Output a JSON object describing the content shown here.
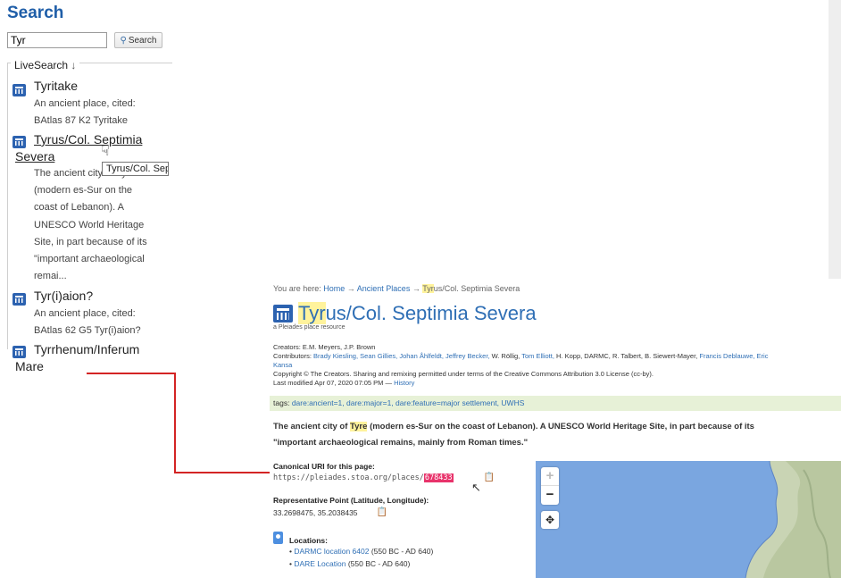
{
  "search": {
    "title": "Search",
    "query": "Tyr",
    "button_label": "Search",
    "livesearch_label": "LiveSearch",
    "livesearch_arrow": "↓"
  },
  "results": [
    {
      "title": "Tyritake",
      "desc": [
        "An ancient place, cited:",
        "BAtlas 87 K2 Tyritake"
      ]
    },
    {
      "title_line1": "Tyrus/Col. Septimia",
      "title_line2": "Severa",
      "desc": [
        "The ancient city of Tyre",
        "(modern es-Sur on the",
        "coast of Lebanon). A",
        "UNESCO World Heritage",
        "Site, in part because of its",
        "\"important archaeological",
        "remai..."
      ]
    },
    {
      "title": "Tyr(i)aion?",
      "desc": [
        "An ancient place, cited:",
        "BAtlas 62 G5 Tyr(i)aion?"
      ]
    },
    {
      "title_line1": "Tyrrhenum/Inferum",
      "title_line2": "Mare"
    }
  ],
  "tooltip": "Tyrus/Col. Septimia Severa",
  "page": {
    "breadcrumb": {
      "prefix": "You are here:",
      "home": "Home",
      "sep": "→",
      "ancient": "Ancient Places",
      "current_hl": "Tyr",
      "current_rest": "us/Col. Septimia Severa"
    },
    "title_hl": "Tyr",
    "title_rest": "us/Col. Septimia Severa",
    "subtitle": "a Pleiades place resource",
    "creators": "Creators: E.M. Meyers, J.P. Brown",
    "contributors_label": "Contributors:",
    "contributors_a": "Brady Kiesling, Sean Gillies, Johan Åhlfeldt, Jeffrey Becker,",
    "contributors_b": "W. Röllig,",
    "contributors_c": "Tom Elliott,",
    "contributors_d": "H. Kopp, DARMC, R. Talbert, B. Siewert-Mayer,",
    "contributors_e": "Francis Deblauwe, Eric",
    "contributors_f": "Kansa",
    "copyright": "Copyright © The Creators. Sharing and remixing permitted under terms of the Creative Commons Attribution 3.0 License (cc-by).",
    "modified": "Last modified Apr 07, 2020 07:05 PM —",
    "history": "History",
    "tags_label": "tags:",
    "tags": "dare:ancient=1, dare:major=1, dare:feature=major settlement, UWHS",
    "desc1_a": "The ancient city of",
    "desc1_hl": "Tyre",
    "desc1_b": "(modern es-Sur on the coast of Lebanon). A UNESCO World Heritage Site, in part because of its",
    "desc2": "\"important archaeological remains, mainly from Roman times.\"",
    "canonical_label": "Canonical URI for this page:",
    "uri_prefix": "https://pleiades.stoa.org/places/",
    "uri_id": "678433",
    "rep_point_label": "Representative Point (Latitude, Longitude):",
    "coords": "33.2698475, 35.2038435",
    "locations_label": "Locations:",
    "loc1_link": "DARMC location 6402",
    "loc1_date": "(550 BC - AD 640)",
    "loc2_link": "DARE Location",
    "loc2_date": "(550 BC - AD 640)"
  },
  "map": {
    "zoom_in": "+",
    "zoom_out": "−",
    "pan": "✥"
  },
  "colors": {
    "link": "#2f6fb5",
    "title": "#1f5ea8",
    "tag_bg": "#e7f1d7",
    "highlight": "#fff39c",
    "selection": "#e8336b",
    "connector": "#d32424"
  }
}
